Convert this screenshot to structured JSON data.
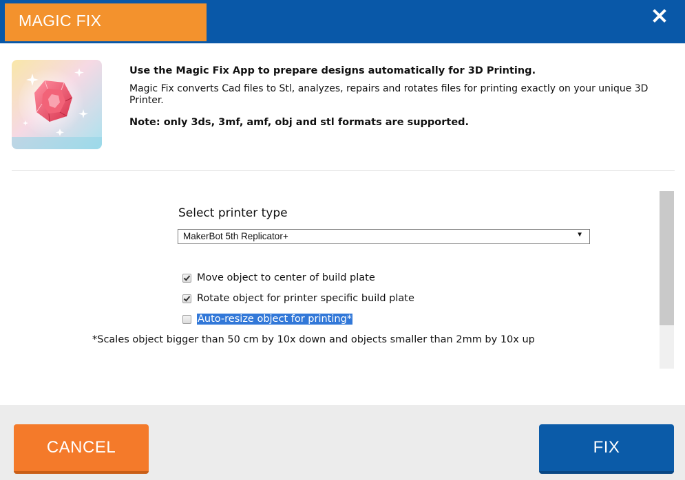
{
  "header": {
    "title": "MAGIC FIX",
    "close_icon": "close-x-icon",
    "accent_color": "#f3922d",
    "bar_color": "#0958a8"
  },
  "intro": {
    "app_icon": "magic-gem-icon",
    "headline": "Use the Magic Fix App to prepare designs automatically for 3D Printing.",
    "description": "Magic Fix converts Cad files to Stl, analyzes, repairs and rotates files for printing exactly on your unique 3D Printer.",
    "note": "Note: only 3ds, 3mf, amf, obj and stl formats are supported."
  },
  "options": {
    "select_label": "Select printer type",
    "printer_selected": "MakerBot 5th Replicator+",
    "checkboxes": [
      {
        "label": "Move object to center of build plate",
        "checked": true
      },
      {
        "label": "Rotate object for printer specific build plate",
        "checked": true
      },
      {
        "label": "Auto-resize object for printing*",
        "checked": false
      }
    ],
    "scale_note": "*Scales object bigger than 50 cm by 10x down and objects smaller than 2mm by 10x up"
  },
  "footer": {
    "cancel_label": "CANCEL",
    "fix_label": "FIX",
    "cancel_color": "#f47a2a",
    "fix_color": "#0b5ba8"
  }
}
